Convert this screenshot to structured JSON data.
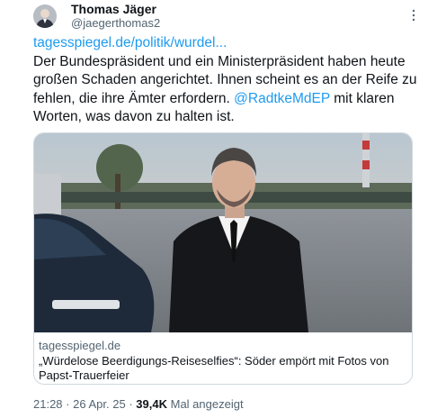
{
  "author": {
    "name": "Thomas Jäger",
    "handle": "@jaegerthomas2",
    "avatar_icon": "profile-photo"
  },
  "tweet": {
    "link_text": "tagesspiegel.de/politik/wurdel...",
    "text_part1": "Der Bundespräsident und ein Ministerpräsident haben heute großen Schaden angerichtet. Ihnen scheint es an der Reife zu fehlen, die ihre Ämter erfordern.",
    "mention": "@RadtkeMdEP",
    "text_part2": "mit klaren Worten, was davon zu halten ist."
  },
  "card": {
    "domain": "tagesspiegel.de",
    "title": "„Würdelose Beerdigungs-Reiseselfies“: Söder empört mit Fotos von Papst-Trauerfeier"
  },
  "meta": {
    "time": "21:28",
    "separator": "·",
    "date": "26 Apr. 25",
    "views_count": "39,4K",
    "views_label": "Mal angezeigt"
  },
  "colors": {
    "link": "#1d9bf0",
    "secondary_text": "#536471",
    "primary_text": "#0f1419",
    "card_border": "#cfd9de"
  }
}
